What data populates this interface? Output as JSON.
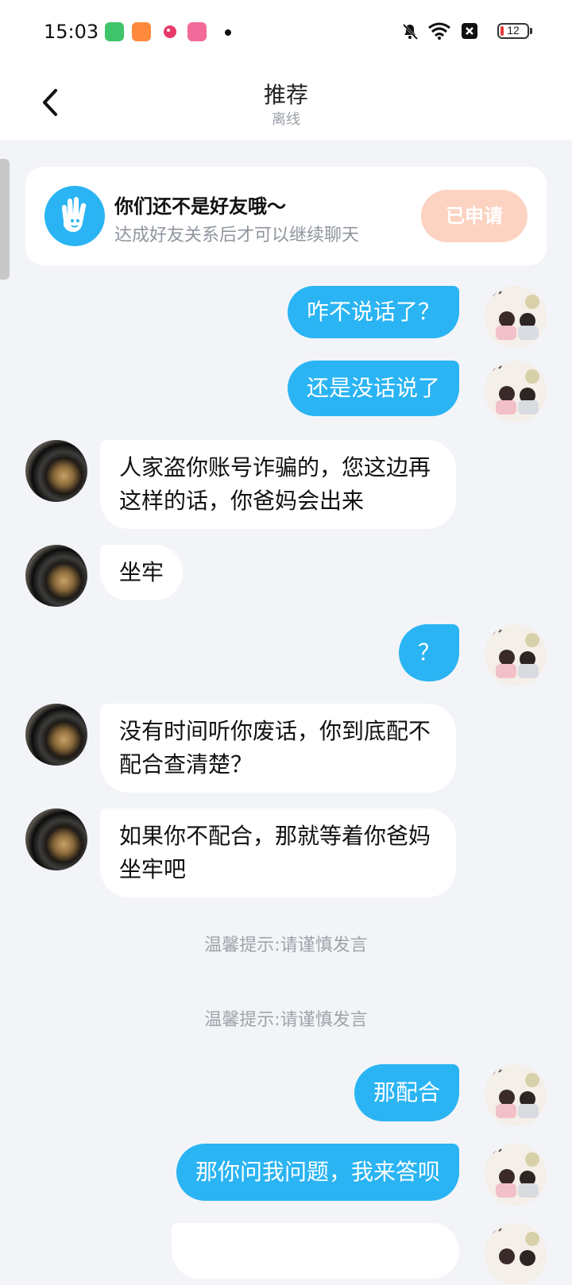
{
  "status_bar": {
    "time": "15:03",
    "battery_level": "12",
    "apps": [
      "green-app-icon",
      "orange-app-icon",
      "red-app-icon",
      "pink-app-icon"
    ]
  },
  "nav": {
    "title": "推荐",
    "subtitle": "离线"
  },
  "friend_notice": {
    "title": "你们还不是好友哦～",
    "description": "达成好友关系后才可以继续聊天",
    "button_label": "已申请"
  },
  "messages": [
    {
      "side": "out",
      "text": "咋不说话了？"
    },
    {
      "side": "out",
      "text": "还是没话说了"
    },
    {
      "side": "in",
      "text": "人家盗你账号诈骗的，您这边再这样的话，你爸妈会出来"
    },
    {
      "side": "in",
      "text": "坐牢"
    },
    {
      "side": "out",
      "text": "？"
    },
    {
      "side": "in",
      "text": "没有时间听你废话，你到底配不配合查清楚？"
    },
    {
      "side": "in",
      "text": "如果你不配合，那就等着你爸妈坐牢吧"
    },
    {
      "side": "out",
      "text": "那配合"
    },
    {
      "side": "out",
      "text": "那你问我问题，我来答呗"
    }
  ],
  "system_tips": [
    "温馨提示:请谨慎发言",
    "温馨提示:请谨慎发言"
  ],
  "colors": {
    "accent": "#2ab4f3",
    "applied_button": "#fcd2c0",
    "background": "#f2f4f8"
  }
}
